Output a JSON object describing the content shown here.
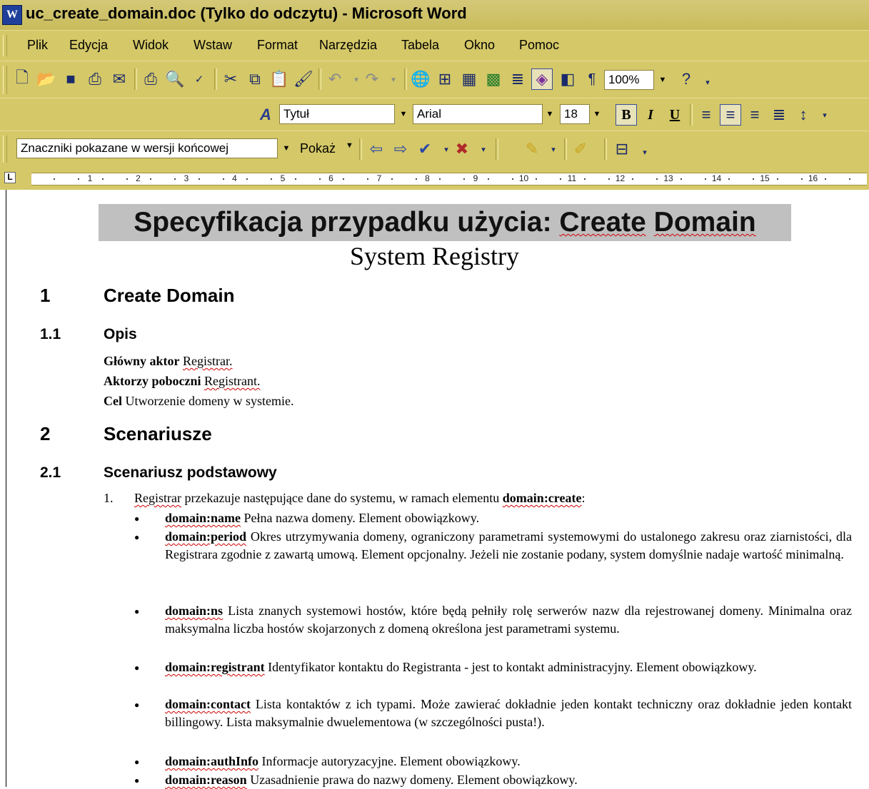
{
  "window": {
    "title": "uc_create_domain.doc (Tylko do odczytu) - Microsoft Word",
    "app_icon": "word-icon"
  },
  "menu": [
    "Plik",
    "Edycja",
    "Widok",
    "Wstaw",
    "Format",
    "Narzędzia",
    "Tabela",
    "Okno",
    "Pomoc"
  ],
  "toolbar": {
    "zoom": "100%",
    "style": "Tytuł",
    "font": "Arial",
    "size": "18",
    "bold": "B",
    "italic": "I",
    "underline": "U",
    "markup_view": "Znaczniki pokazane w wersji końcowej",
    "show_label": "Pokaż"
  },
  "ruler": {
    "numbers": [
      "1",
      "2",
      "3",
      "4",
      "5",
      "6",
      "7",
      "8",
      "9",
      "10",
      "11",
      "12",
      "13",
      "14",
      "15",
      "16"
    ]
  },
  "doc": {
    "title": "Specyfikacja przypadku użycia: Create Domain",
    "subtitle": "System Registry",
    "s1_num": "1",
    "s1_title": "Create Domain",
    "s11_num": "1.1",
    "s11_title": "Opis",
    "actor_label": "Główny aktor",
    "actor_value": "Registrar.",
    "secondary_label": "Aktorzy poboczni",
    "secondary_value": "Registrant.",
    "goal_label": "Cel",
    "goal_value": "Utworzenie domeny w systemie.",
    "s2_num": "2",
    "s2_title": "Scenariusze",
    "s21_num": "2.1",
    "s21_title": "Scenariusz podstawowy",
    "step1_num": "1.",
    "step1_a": "Registrar",
    "step1_b": "przekazuje następujące dane do systemu, w ramach elementu",
    "step1_elem": "domain:create",
    "step1_end": ":",
    "bullets": [
      {
        "term": "domain:name",
        "text": "Pełna nazwa domeny. Element obowiązkowy."
      },
      {
        "term": "domain:period",
        "text": "Okres utrzymywania domeny, ograniczony parametrami systemowymi do ustalonego zakresu oraz ziarnistości, dla Registrara zgodnie z zawartą umową. Element opcjonalny. Jeżeli nie zostanie podany, system domyślnie nadaje wartość minimalną."
      },
      {
        "term": "domain:ns",
        "text": "Lista znanych systemowi hostów, które będą pełniły rolę serwerów nazw dla rejestrowanej domeny. Minimalna oraz maksymalna liczba hostów skojarzonych z domeną określona jest parametrami systemu."
      },
      {
        "term": "domain:registrant",
        "text": "Identyfikator kontaktu do Registranta - jest to kontakt administracyjny. Element obowiązkowy."
      },
      {
        "term": "domain:contact",
        "text": "Lista kontaktów z ich typami. Może zawierać dokładnie jeden kontakt techniczny oraz dokładnie jeden kontakt billingowy. Lista maksymalnie dwuelementowa (w szczególności pusta!)."
      },
      {
        "term": "domain:authInfo",
        "text": "Informacje autoryzacyjne. Element obowiązkowy."
      },
      {
        "term": "domain:reason",
        "text": "Uzasadnienie prawa do nazwy domeny. Element obowiązkowy."
      }
    ]
  }
}
